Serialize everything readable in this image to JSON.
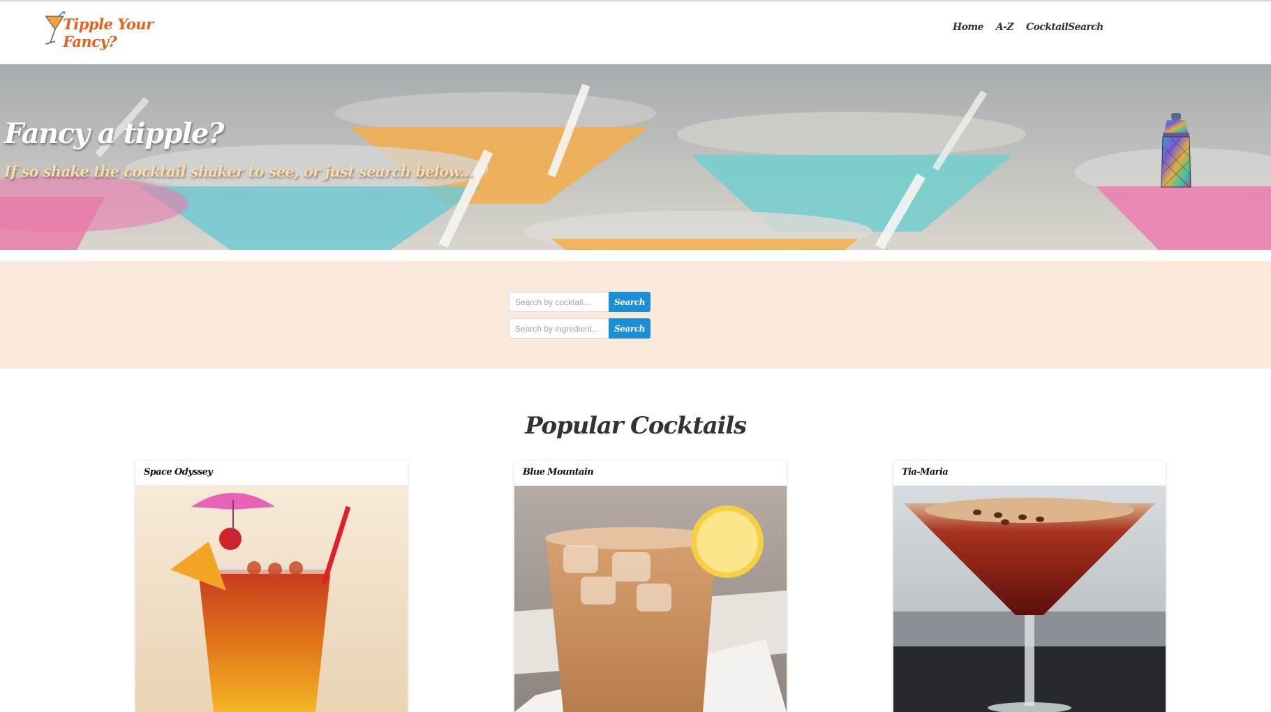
{
  "brand": {
    "name": "Tipple Your Fancy?",
    "accent": "#e3641f"
  },
  "nav": {
    "items": [
      "Home",
      "A-Z",
      "CocktailSearch"
    ]
  },
  "hero": {
    "title": "Fancy a tipple?",
    "subtitle": "If so shake the cocktail shaker to see, or just search below...",
    "shaker_icon": "cocktail-shaker-icon"
  },
  "search": {
    "cocktail_placeholder": "Search by cocktail...",
    "ingredient_placeholder": "Search by ingredient...",
    "button_label": "Search",
    "button_color": "#1a8fd6",
    "panel_color": "#fbeadb"
  },
  "popular": {
    "title": "Popular Cocktails",
    "cards": [
      {
        "name": "Space Odyssey"
      },
      {
        "name": "Blue Mountain"
      },
      {
        "name": "Tia-Maria"
      }
    ]
  }
}
